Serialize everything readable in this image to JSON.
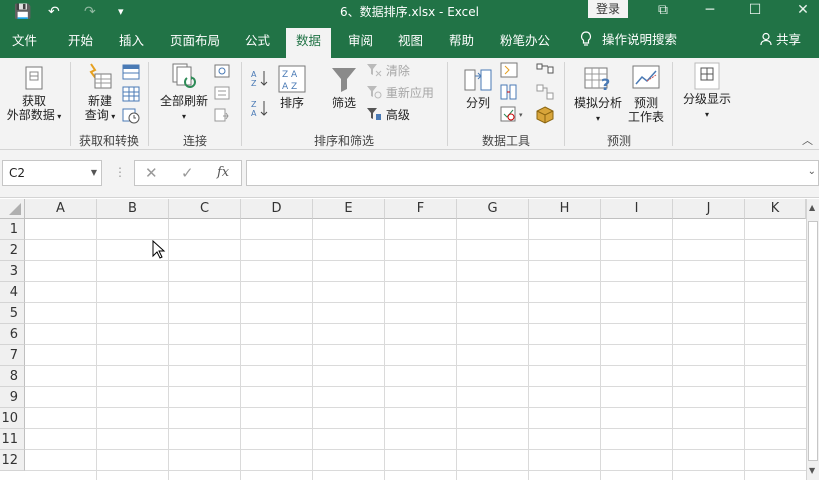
{
  "window": {
    "title": "6、数据排序.xlsx  -  Excel",
    "login": "登录",
    "qa_save": "💾",
    "qa_undo": "↶",
    "qa_redo": "↷",
    "qa_more": "▾",
    "min": "─",
    "max": "☐",
    "close": "✕",
    "ribbon_opts": "⧉"
  },
  "tabs": [
    {
      "label": "文件"
    },
    {
      "label": "开始"
    },
    {
      "label": "插入"
    },
    {
      "label": "页面布局"
    },
    {
      "label": "公式"
    },
    {
      "label": "数据"
    },
    {
      "label": "审阅"
    },
    {
      "label": "视图"
    },
    {
      "label": "帮助"
    },
    {
      "label": "粉笔办公"
    }
  ],
  "tell_me": "操作说明搜索",
  "share": "共享",
  "ribbon": {
    "get_external_1": "获取",
    "get_external_2": "外部数据",
    "new_query_1": "新建",
    "new_query_2": "查询",
    "refresh_all": "全部刷新",
    "sort": "排序",
    "filter": "筛选",
    "clear": "清除",
    "reapply": "重新应用",
    "advanced": "高级",
    "split": "分列",
    "whatif": "模拟分析",
    "forecast_1": "预测",
    "forecast_2": "工作表",
    "outline": "分级显示",
    "groups": {
      "get_transform": "获取和转换",
      "connections": "连接",
      "sort_filter": "排序和筛选",
      "data_tools": "数据工具",
      "forecast": "预测"
    }
  },
  "formula_bar": {
    "name_box": "C2",
    "cancel": "✕",
    "enter": "✓",
    "fx": "fx",
    "value": ""
  },
  "grid": {
    "columns": [
      "A",
      "B",
      "C",
      "D",
      "E",
      "F",
      "G",
      "H",
      "I",
      "J",
      "K"
    ],
    "rows": [
      "1",
      "2",
      "3",
      "4",
      "5",
      "6",
      "7",
      "8",
      "9",
      "10",
      "11",
      "12"
    ]
  },
  "colors": {
    "brand": "#217346",
    "ribbon_bg": "#f3f3f3"
  }
}
